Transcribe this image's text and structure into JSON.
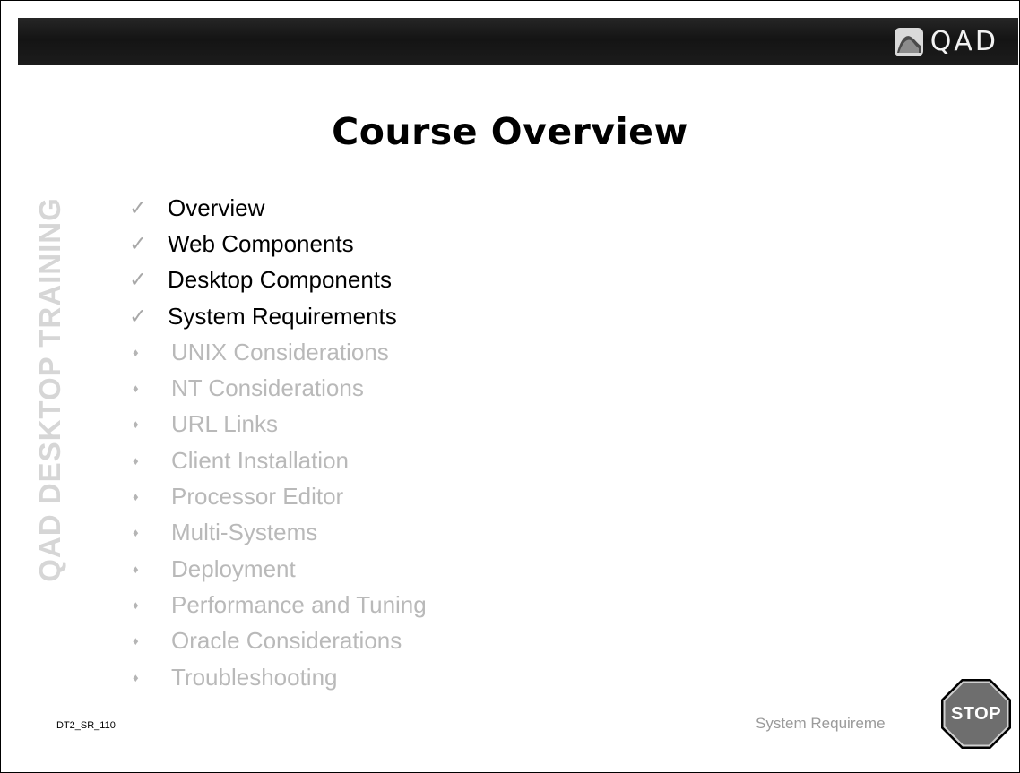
{
  "header": {
    "logo_text": "QAD",
    "logo_icon": "qad-swoosh-icon"
  },
  "title": "Course Overview",
  "sidebar_text": "QAD DESKTOP TRAINING",
  "topics": [
    {
      "label": "Overview",
      "status": "done"
    },
    {
      "label": "Web Components",
      "status": "done"
    },
    {
      "label": "Desktop Components",
      "status": "done"
    },
    {
      "label": "System Requirements",
      "status": "done"
    },
    {
      "label": "UNIX Considerations",
      "status": "pending"
    },
    {
      "label": "NT Considerations",
      "status": "pending"
    },
    {
      "label": "URL Links",
      "status": "pending"
    },
    {
      "label": "Client Installation",
      "status": "pending"
    },
    {
      "label": "Processor Editor",
      "status": "pending"
    },
    {
      "label": "Multi-Systems",
      "status": "pending"
    },
    {
      "label": "Deployment",
      "status": "pending"
    },
    {
      "label": "Performance and Tuning",
      "status": "pending"
    },
    {
      "label": "Oracle Considerations",
      "status": "pending"
    },
    {
      "label": "Troubleshooting",
      "status": "pending"
    }
  ],
  "footer": {
    "slide_id": "DT2_SR_110",
    "section": "System Requireme",
    "stop_label": "STOP"
  },
  "colors": {
    "banner": "#1c1c1c",
    "done_text": "#000000",
    "pending_text": "#b9b9b9",
    "stop_sign": "#6e6e6e"
  }
}
